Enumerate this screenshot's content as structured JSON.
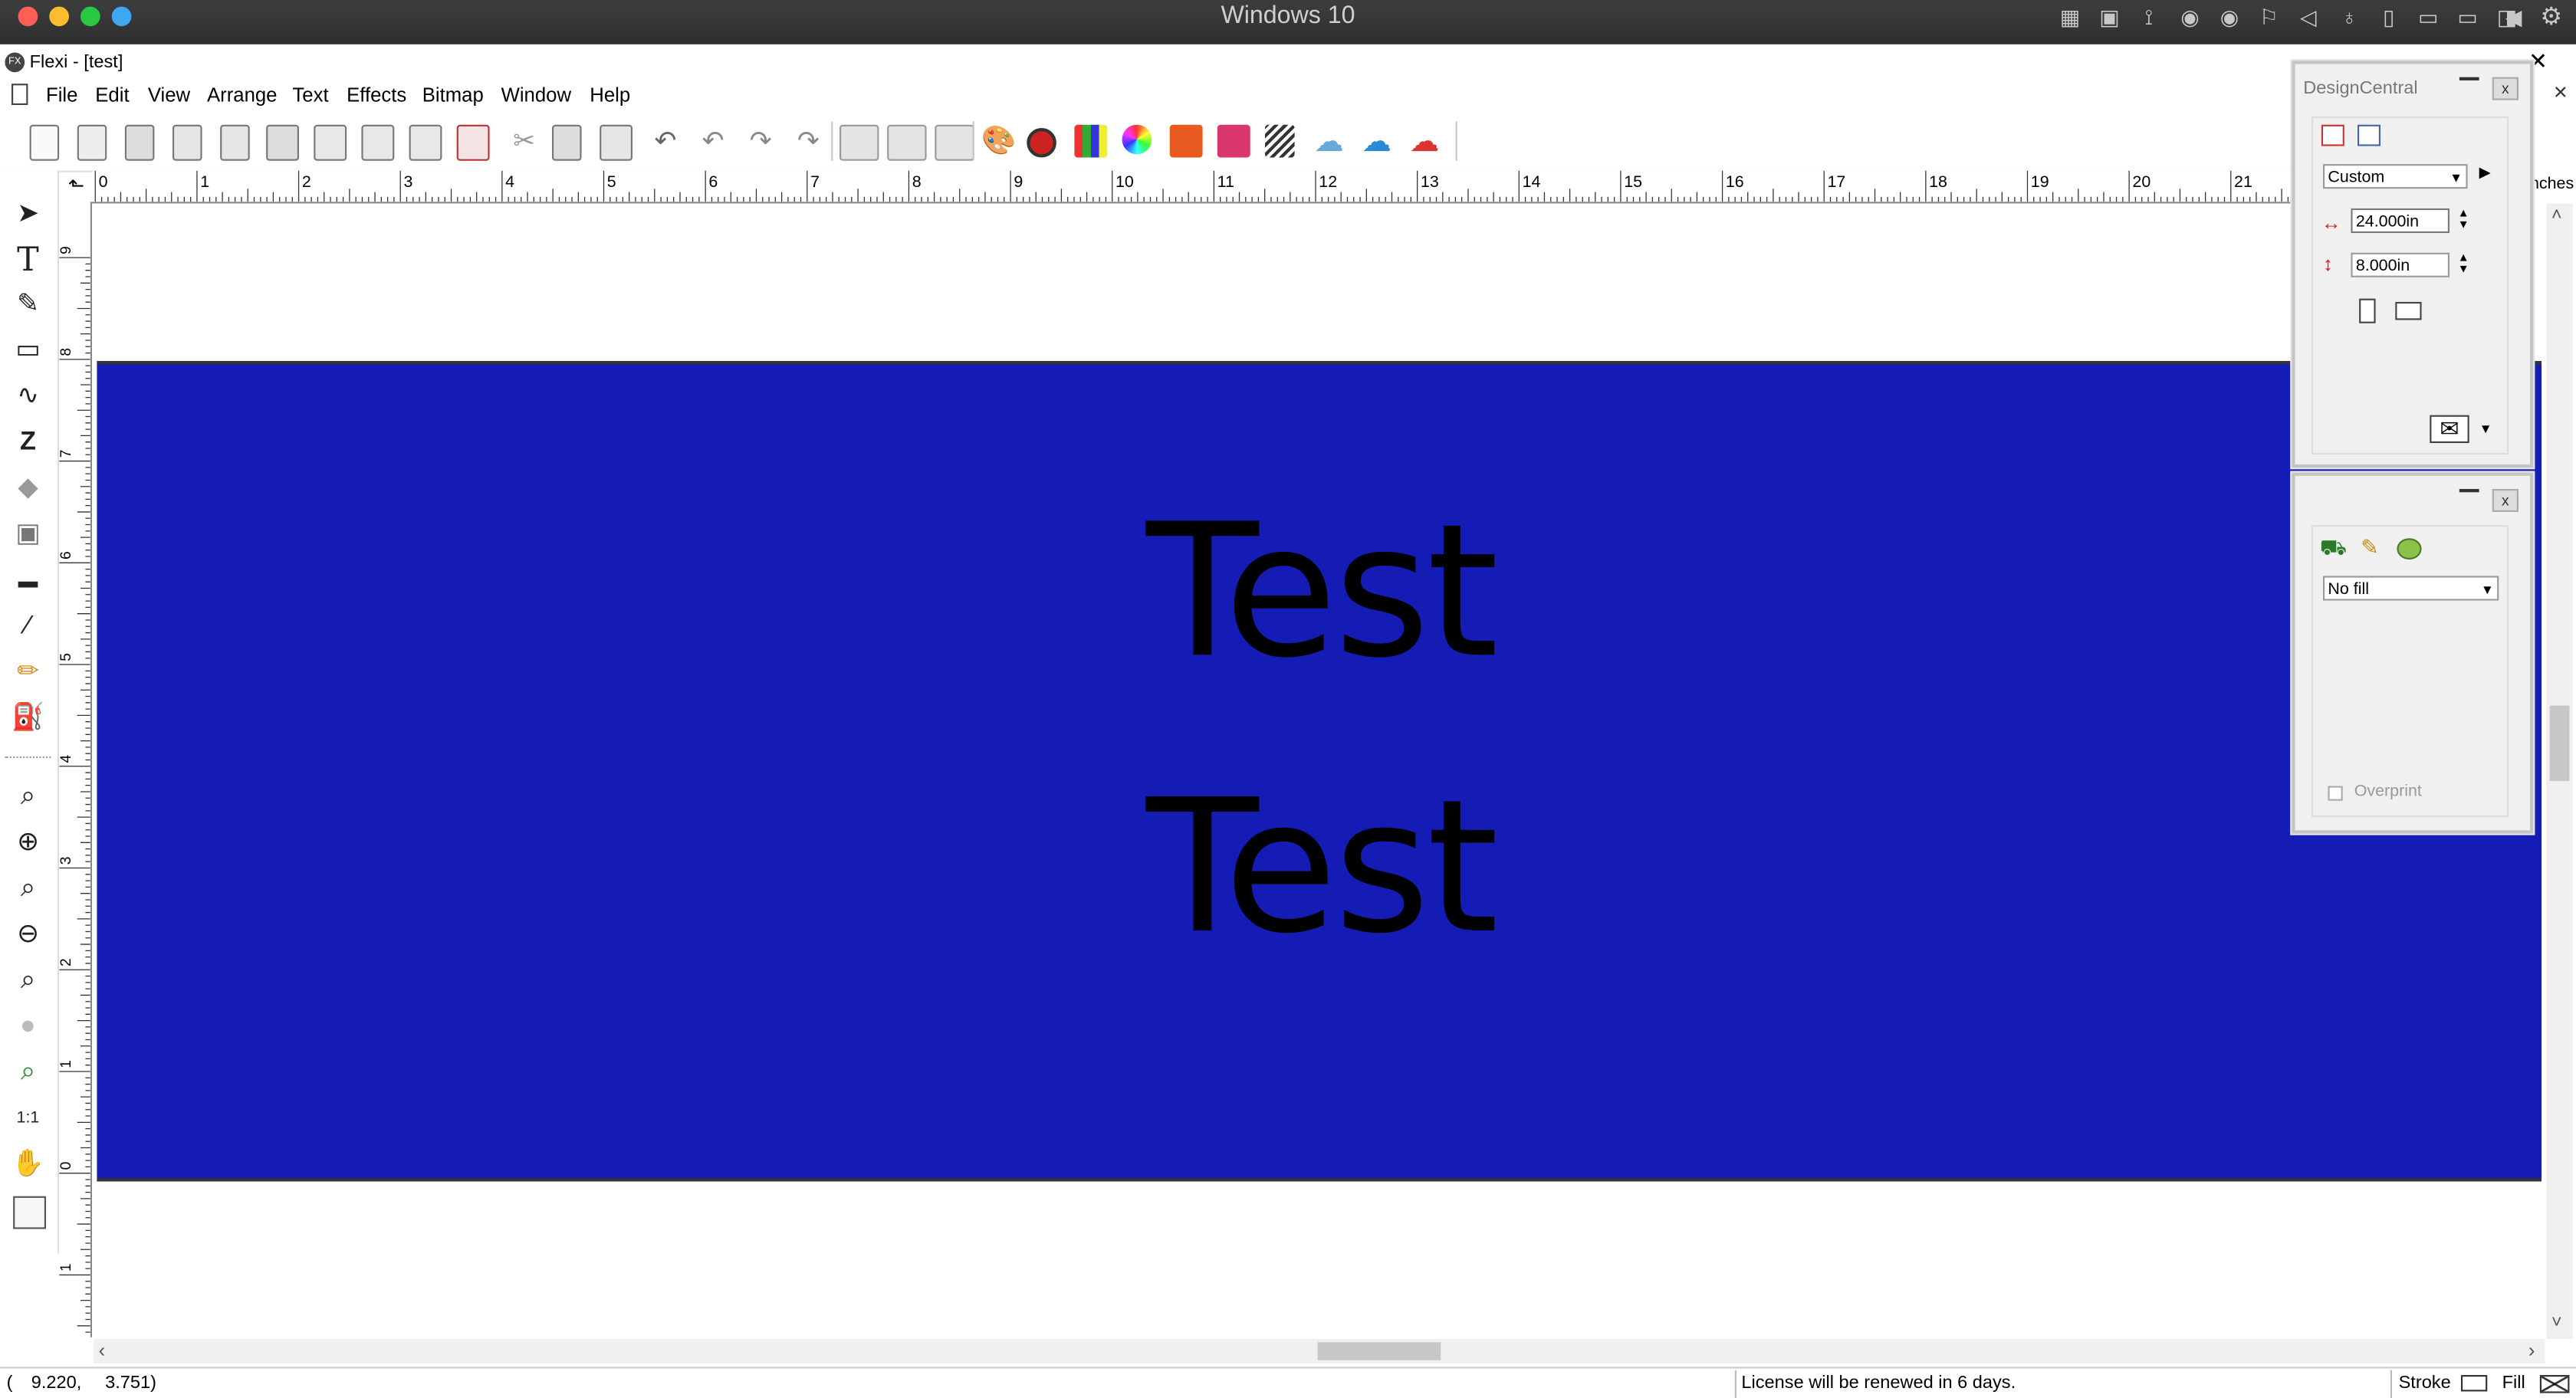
{
  "host": {
    "title": "Windows 10",
    "traffic_lights": [
      "close",
      "minimize",
      "zoom",
      "fullscreen"
    ],
    "status_icons": [
      "keyboard-icon",
      "cpu-icon",
      "usb-icon",
      "cd-icon",
      "cd-icon",
      "network-flag-icon",
      "speaker-icon",
      "microphone-icon",
      "phone-icon",
      "tablet-icon",
      "camera-icon",
      "folder-icon",
      "arrow-left-icon",
      "gear-icon"
    ]
  },
  "app": {
    "title": "Flexi - [test]",
    "logo_text": "FX"
  },
  "menu": [
    "File",
    "Edit",
    "View",
    "Arrange",
    "Text",
    "Effects",
    "Bitmap",
    "Window",
    "Help"
  ],
  "ruler": {
    "h_labels": [
      "0",
      "1",
      "2",
      "3",
      "4",
      "5",
      "6",
      "7",
      "8",
      "9",
      "10",
      "11",
      "12",
      "13",
      "14",
      "15",
      "16",
      "17",
      "18",
      "19",
      "20",
      "21"
    ],
    "v_labels": [
      "9",
      "8",
      "7",
      "6",
      "5",
      "4",
      "3",
      "2",
      "1",
      "0",
      "1"
    ],
    "units_label": "nches"
  },
  "canvas": {
    "rect_color": "#151cb6",
    "text_line_1": "Test",
    "text_line_2": "Test"
  },
  "design_central": {
    "title": "DesignCentral",
    "preset_value": "Custom",
    "width_value": "24.000in",
    "height_value": "8.000in"
  },
  "fill_panel": {
    "fill_value": "No fill",
    "overprint_label": "Overprint"
  },
  "status": {
    "coords_x": "9.220,",
    "coords_y": "3.751)",
    "coords_prefix": "(",
    "license_text": "License will be renewed in 6 days.",
    "stroke_label": "Stroke",
    "fill_label": "Fill"
  },
  "colors": {
    "accent_blue": "#151cb6",
    "host_bar": "#333333",
    "tl_red": "#ff5f57",
    "tl_yellow": "#febc2e",
    "tl_green": "#28c840",
    "tl_blue": "#3ea7f0"
  }
}
